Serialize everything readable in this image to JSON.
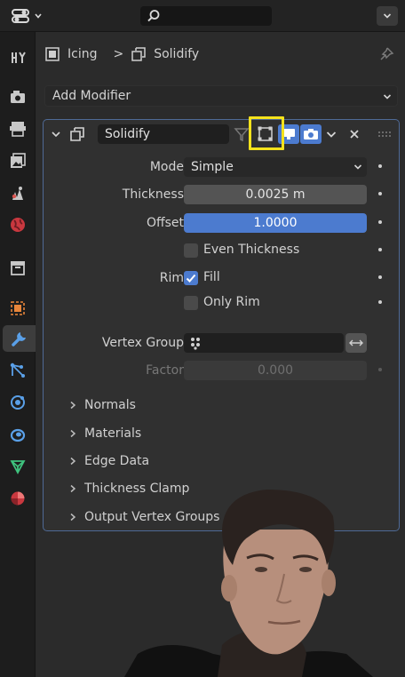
{
  "topbar": {
    "editor_type_icon": "properties-editor-icon",
    "search_placeholder": "",
    "collapse_icon": "chevron-down-icon"
  },
  "sidebar": {
    "tabs": [
      {
        "name": "tool",
        "icon": "tool-icon"
      },
      {
        "name": "render",
        "icon": "render-icon"
      },
      {
        "name": "output",
        "icon": "output-icon"
      },
      {
        "name": "view-layer",
        "icon": "view-layer-icon"
      },
      {
        "name": "scene",
        "icon": "scene-icon"
      },
      {
        "name": "world",
        "icon": "world-icon"
      },
      {
        "name": "collection",
        "icon": "collection-icon"
      },
      {
        "name": "object",
        "icon": "object-icon"
      },
      {
        "name": "modifiers",
        "icon": "wrench-icon",
        "active": true
      },
      {
        "name": "particles",
        "icon": "particles-icon"
      },
      {
        "name": "physics",
        "icon": "physics-icon"
      },
      {
        "name": "constraints",
        "icon": "constraints-icon"
      },
      {
        "name": "data",
        "icon": "mesh-data-icon"
      },
      {
        "name": "material",
        "icon": "material-icon"
      }
    ]
  },
  "breadcrumb": {
    "object": "Icing",
    "separator": ">",
    "modifier": "Solidify"
  },
  "add_modifier": {
    "label": "Add Modifier"
  },
  "modifier": {
    "name": "Solidify",
    "mode": {
      "label": "Mode",
      "value": "Simple"
    },
    "thickness": {
      "label": "Thickness",
      "value": "0.0025 m"
    },
    "offset": {
      "label": "Offset",
      "value": "1.0000",
      "fraction": 1.0
    },
    "even_thickness": {
      "label": "Even Thickness",
      "checked": false
    },
    "rim": {
      "label": "Rim"
    },
    "fill": {
      "label": "Fill",
      "checked": true
    },
    "only_rim": {
      "label": "Only Rim",
      "checked": false
    },
    "vertex_group": {
      "label": "Vertex Group",
      "value": ""
    },
    "factor": {
      "label": "Factor",
      "value": "0.000"
    },
    "subpanels": [
      "Normals",
      "Materials",
      "Edge Data",
      "Thickness Clamp",
      "Output Vertex Groups"
    ]
  },
  "colors": {
    "accent": "#4c7bcf",
    "highlight": "#f4e21c",
    "panel_border": "#4f6a96"
  }
}
